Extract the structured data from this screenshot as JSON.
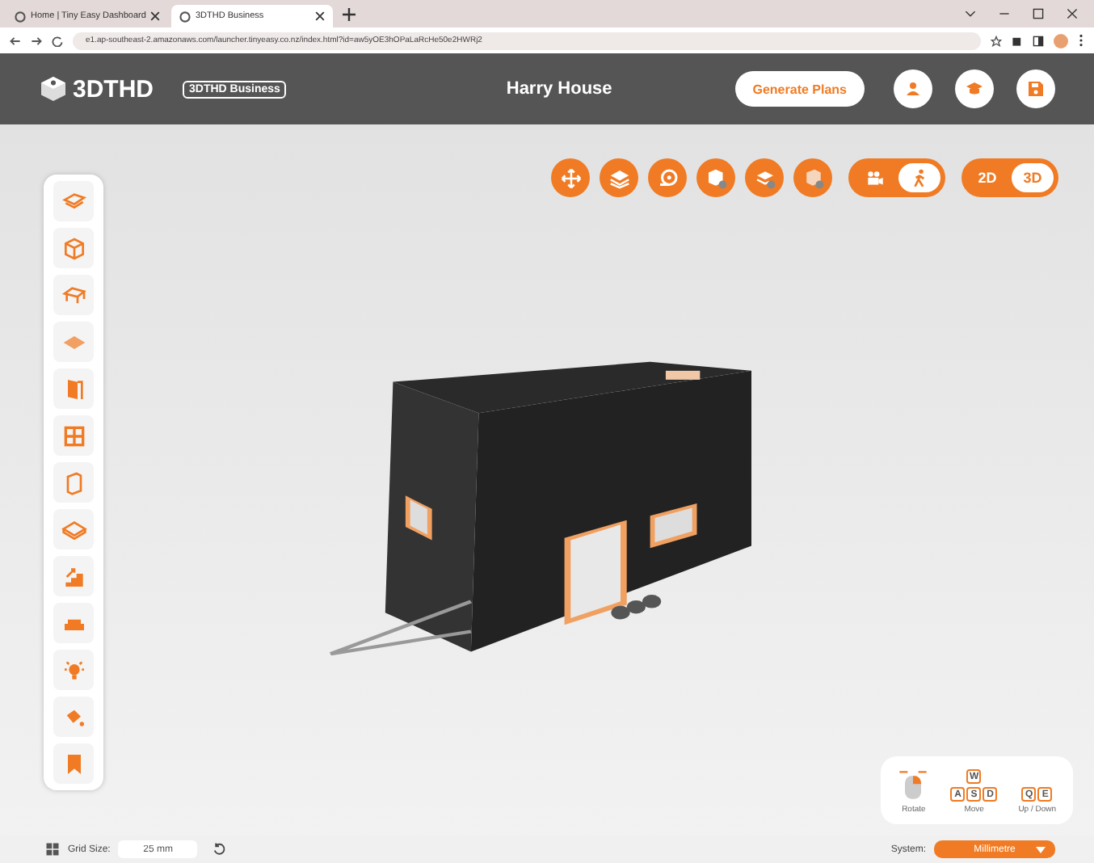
{
  "browser": {
    "tabs": [
      {
        "label": "Home | Tiny Easy Dashboard",
        "selected": false
      },
      {
        "label": "3DTHD Business",
        "selected": true
      }
    ],
    "url": "e1.ap-southeast-2.amazonaws.com/launcher.tinyeasy.co.nz/index.html?id=aw5yOE3hOPaLaRcHe50e2HWRj2"
  },
  "header": {
    "logo": "3DTHD",
    "edition": "3DTHD Business",
    "project_title": "Harry House",
    "generate_button": "Generate Plans"
  },
  "view_toggle": [
    {
      "kind": "camera",
      "selected": false
    },
    {
      "kind": "walk",
      "selected": true
    }
  ],
  "dimension_toggle": [
    {
      "label": "2D",
      "selected": false
    },
    {
      "label": "3D",
      "selected": true
    }
  ],
  "controls_help": {
    "rotate_label": "Rotate",
    "move_keys": [
      [
        "W"
      ],
      [
        "A",
        "S",
        "D"
      ]
    ],
    "move_label": "Move",
    "updown_keys": [
      "Q",
      "E"
    ],
    "updown_label": "Up / Down"
  },
  "status_bar": {
    "grid_label": "Grid Size:",
    "grid_value": "25 mm",
    "system_label": "System:",
    "system_value": "Millimetre"
  }
}
